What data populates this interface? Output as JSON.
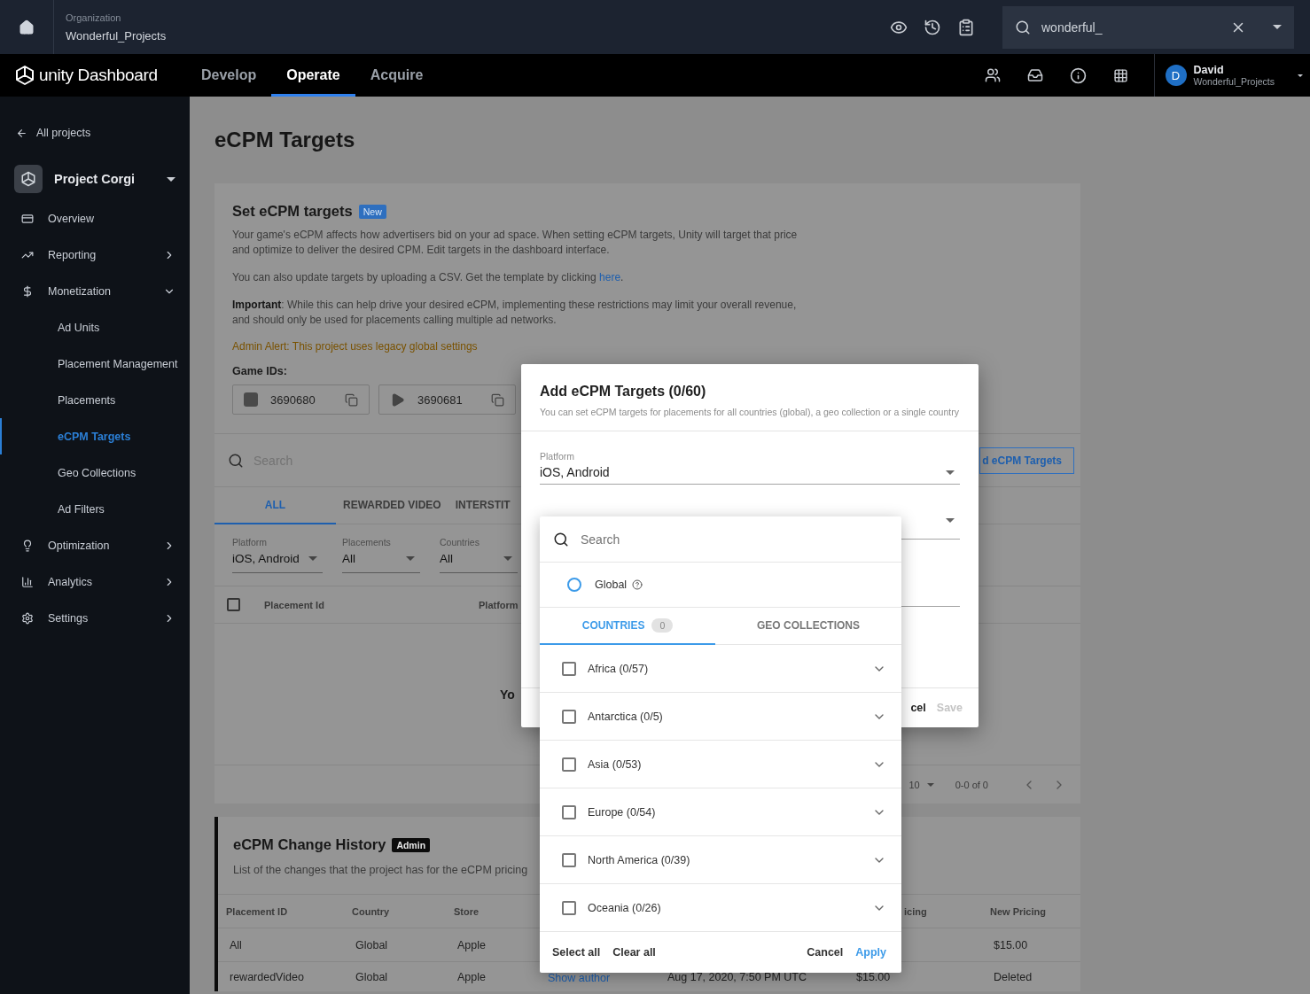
{
  "topbar": {
    "org_label": "Organization",
    "org_name": "Wonderful_Projects",
    "search_value": "wonderful_"
  },
  "navbar": {
    "logo": "unity Dashboard",
    "tabs": [
      {
        "label": "Develop",
        "selected": false
      },
      {
        "label": "Operate",
        "selected": true
      },
      {
        "label": "Acquire",
        "selected": false
      }
    ],
    "user": {
      "initial": "D",
      "name": "David",
      "org": "Wonderful_Projects"
    }
  },
  "sidebar": {
    "back": "All projects",
    "project": "Project Corgi",
    "items": [
      {
        "label": "Overview",
        "kind": "link"
      },
      {
        "label": "Reporting",
        "kind": "group",
        "expanded": false
      },
      {
        "label": "Monetization",
        "kind": "group",
        "expanded": true,
        "children": [
          {
            "label": "Ad Units",
            "selected": false
          },
          {
            "label": "Placement Management",
            "selected": false
          },
          {
            "label": "Placements",
            "selected": false
          },
          {
            "label": "eCPM Targets",
            "selected": true
          },
          {
            "label": "Geo Collections",
            "selected": false
          },
          {
            "label": "Ad Filters",
            "selected": false
          }
        ]
      },
      {
        "label": "Optimization",
        "kind": "group",
        "expanded": false
      },
      {
        "label": "Analytics",
        "kind": "group",
        "expanded": false
      },
      {
        "label": "Settings",
        "kind": "group",
        "expanded": false
      }
    ]
  },
  "page": {
    "title": "eCPM Targets"
  },
  "intro_card": {
    "title": "Set eCPM targets",
    "badge": "New",
    "paragraph_1": "Your game's eCPM affects how advertisers bid on your ad space. When setting eCPM targets, Unity will target that price and optimize to deliver the desired CPM. Edit targets in the dashboard interface.",
    "paragraph_2": {
      "text": "You can also update targets by uploading a CSV. Get the template by clicking ",
      "link": "here",
      "after": "."
    },
    "paragraph_3": "**Important**: While this can help drive your desired eCPM, implementing these restrictions may limit your overall revenue, and should only be used for placements calling multiple ad networks.",
    "alert": "Admin Alert: This project uses legacy global settings",
    "game_ids_label": "Game IDs:",
    "game_ids": [
      "3690680",
      "3690681"
    ]
  },
  "targets_card": {
    "search_placeholder": "Search",
    "add_button": "d eCPM Targets",
    "tabs": [
      {
        "label": "ALL",
        "selected": true
      },
      {
        "label": "REWARDED VIDEO",
        "selected": false
      },
      {
        "label": "INTERSTIT",
        "selected": false
      }
    ],
    "filters": [
      {
        "label": "Platform",
        "value": "iOS, Android"
      },
      {
        "label": "Placements",
        "value": "All"
      },
      {
        "label": "Countries",
        "value": "All"
      }
    ],
    "select_all_checked": false,
    "columns": [
      "Placement Id",
      "Platform"
    ],
    "empty_text": "Yo",
    "pagination": {
      "per_page": "10",
      "range": "0-0 of 0"
    }
  },
  "history_card": {
    "title": "eCPM Change History",
    "badge": "Admin",
    "description": "List of the changes that the project has for the eCPM pricing",
    "header": {
      "placement_id": "Placement ID",
      "country": "Country",
      "store": "Store",
      "old_pricing": "icing",
      "new_pricing": "New Pricing"
    },
    "rows": [
      {
        "placement_id": "All",
        "country": "Global",
        "store": "Apple",
        "new_pricing": "$15.00"
      },
      {
        "placement_id": "rewardedVideo",
        "country": "Global",
        "store": "Apple",
        "author": "Show author",
        "date": "Aug 17, 2020, 7:50 PM UTC",
        "old_pricing": "$15.00",
        "new_pricing": "Deleted"
      }
    ]
  },
  "dialog": {
    "title": "Add eCPM Targets (0/60)",
    "subtitle": "You can set eCPM targets for placements for all countries (global), a geo collection or a single country",
    "platform": {
      "label": "Platform",
      "value": "iOS, Android"
    },
    "cancel": "cel",
    "save": "Save",
    "save_disabled": true
  },
  "location_menu": {
    "search_placeholder": "Search",
    "global": {
      "label": "Global",
      "checked": false
    },
    "tabs": [
      {
        "label": "COUNTRIES",
        "count": "0",
        "selected": true
      },
      {
        "label": "GEO COLLECTIONS",
        "selected": false
      }
    ],
    "regions": [
      {
        "label": "Africa (0/57)",
        "checked": false,
        "expanded": false
      },
      {
        "label": "Antarctica (0/5)",
        "checked": false,
        "expanded": false
      },
      {
        "label": "Asia (0/53)",
        "checked": false,
        "expanded": false
      },
      {
        "label": "Europe (0/54)",
        "checked": false,
        "expanded": false
      },
      {
        "label": "North America (0/39)",
        "checked": false,
        "expanded": false
      },
      {
        "label": "Oceania (0/26)",
        "checked": false,
        "expanded": false
      }
    ],
    "select_all": "Select all",
    "clear_all": "Clear all",
    "cancel": "Cancel",
    "apply": "Apply"
  }
}
